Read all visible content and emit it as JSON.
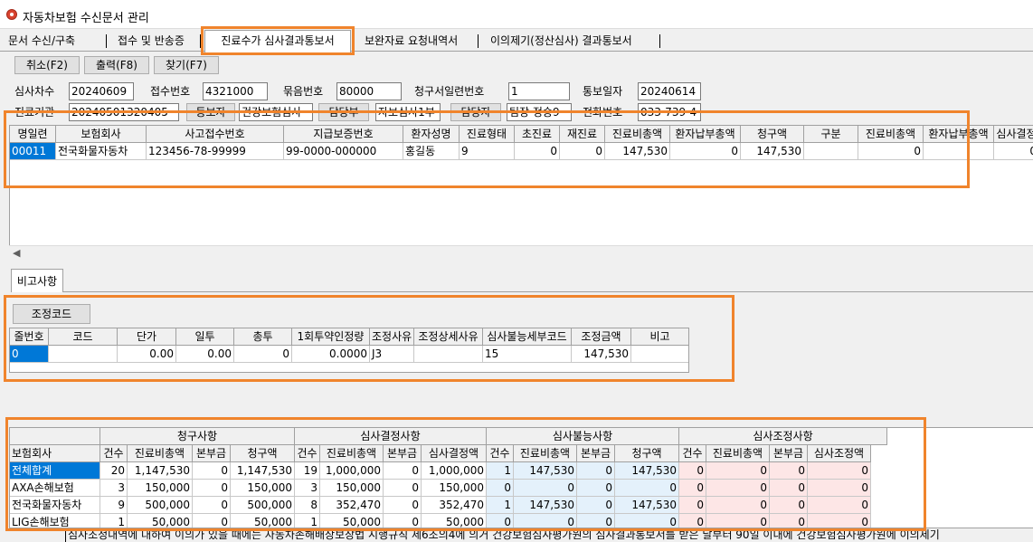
{
  "window": {
    "title": "자동차보험 수신문서 관리"
  },
  "tabs": [
    {
      "label": "문서 수신/구축"
    },
    {
      "label": "접수 및 반송증"
    },
    {
      "label": "진료수가 심사결과통보서"
    },
    {
      "label": "보완자료 요청내역서"
    },
    {
      "label": "이의제기(정산심사) 결과통보서"
    }
  ],
  "toolbar": {
    "cancel": "취소(F2)",
    "print": "출력(F8)",
    "find": "찾기(F7)"
  },
  "form": {
    "row1": [
      {
        "label": "심사차수",
        "value": "20240609"
      },
      {
        "label": "접수번호",
        "value": "4321000"
      },
      {
        "label": "묶음번호",
        "value": "80000"
      },
      {
        "label": "청구서일련번호",
        "value": "1"
      },
      {
        "label": "통보일자",
        "value": "20240614"
      }
    ],
    "row2": {
      "label1": "진료기관",
      "value1": "20240501320405",
      "btn1": "등보자",
      "value2": "건강보험심사",
      "btn2": "담당부",
      "value3": "자보심사1부",
      "btn3": "담당자",
      "value4": "팀장 정승9",
      "label2": "전화번호",
      "value5": "033-739-4"
    }
  },
  "top_grid": {
    "headers": [
      "명일련",
      "보험회사",
      "사고접수번호",
      "지급보증번호",
      "환자성명",
      "진료형태",
      "초진료",
      "재진료",
      "진료비총액",
      "환자납부총액",
      "청구액",
      "구분",
      "진료비총액",
      "환자납부총액",
      "심사결정"
    ],
    "rows": [
      [
        "00011",
        "전국화물자동차",
        "123456-78-99999",
        "99-0000-000000",
        "홍길동",
        "9",
        "0",
        "0",
        "147,530",
        "0",
        "147,530",
        "",
        "0",
        "",
        "0"
      ]
    ]
  },
  "remarks_tab": "비고사항",
  "adjust": {
    "button": "조정코드",
    "headers": [
      "줄번호",
      "코드",
      "단가",
      "일투",
      "총투",
      "1회투약인정량",
      "조정사유",
      "조정상세사유",
      "심사불능세부코드",
      "조정금액",
      "비고"
    ],
    "rows": [
      [
        "0",
        "",
        "0.00",
        "0.00",
        "0",
        "0.0000",
        "J3",
        "",
        "15",
        "147,530",
        ""
      ]
    ]
  },
  "summary": {
    "groups": [
      "청구사항",
      "심사결정사항",
      "심사불능사항",
      "심사조정사항"
    ],
    "headers": [
      "보험회사",
      "건수",
      "진료비총액",
      "본부금",
      "청구액",
      "건수",
      "진료비총액",
      "본부금",
      "심사결정액",
      "건수",
      "진료비총액",
      "본부금",
      "청구액",
      "건수",
      "진료비총액",
      "본부금",
      "심사조정액"
    ],
    "rows": [
      [
        "전체합계",
        "20",
        "1,147,530",
        "0",
        "1,147,530",
        "19",
        "1,000,000",
        "0",
        "1,000,000",
        "1",
        "147,530",
        "0",
        "147,530",
        "0",
        "0",
        "0",
        "0"
      ],
      [
        "AXA손해보험",
        "3",
        "150,000",
        "0",
        "150,000",
        "3",
        "150,000",
        "0",
        "150,000",
        "0",
        "0",
        "0",
        "0",
        "0",
        "0",
        "0",
        "0"
      ],
      [
        "전국화물자동차",
        "9",
        "500,000",
        "0",
        "500,000",
        "8",
        "352,470",
        "0",
        "352,470",
        "1",
        "147,530",
        "0",
        "147,530",
        "0",
        "0",
        "0",
        "0"
      ],
      [
        "LIG손해보험",
        "1",
        "50,000",
        "0",
        "50,000",
        "1",
        "50,000",
        "0",
        "50,000",
        "0",
        "0",
        "0",
        "0",
        "0",
        "0",
        "0",
        "0"
      ]
    ]
  },
  "footer_note": "심사조정내역에 대하여 이의가 있을 때에는 자동차손해배상보장법 시행규칙 제6조의4에 의거 건강보험심사평가원의 심사결과통보서를 받은 날부터 90일 이내에 건강보험심사평가원에 이의제기",
  "colors": {
    "highlight": "#f0842c",
    "selection": "#0078d7"
  }
}
